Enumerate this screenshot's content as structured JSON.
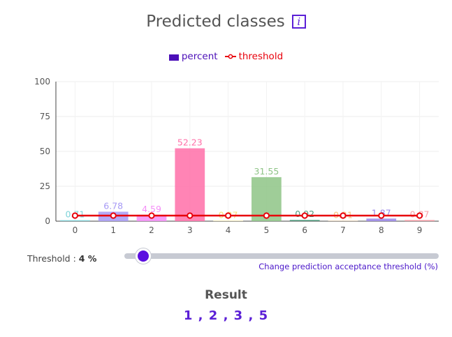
{
  "header": {
    "title": "Predicted classes",
    "info_glyph": "i"
  },
  "legend": {
    "percent_label": "percent",
    "threshold_label": "threshold"
  },
  "chart_data": {
    "type": "bar",
    "categories": [
      "0",
      "1",
      "2",
      "3",
      "4",
      "5",
      "6",
      "7",
      "8",
      "9"
    ],
    "series": [
      {
        "name": "percent",
        "values": [
          0.71,
          6.78,
          4.59,
          52.23,
          0.27,
          31.55,
          0.92,
          0.21,
          1.87,
          0.87
        ],
        "labels": [
          "0.71",
          "6.78",
          "4.59",
          "52.23",
          "0.27",
          "31.55",
          "0.92",
          "0.21",
          "1.87",
          "0.87"
        ],
        "colors": [
          "#7ed3d9",
          "#a79af5",
          "#f48df7",
          "#ff6fa8",
          "#f6e27a",
          "#8ec486",
          "#4f9a7d",
          "#f7c27a",
          "#9a86e8",
          "#f7a0a8"
        ]
      },
      {
        "name": "threshold",
        "type": "line",
        "values": [
          4,
          4,
          4,
          4,
          4,
          4,
          4,
          4,
          4,
          4
        ],
        "color": "#e8000b"
      }
    ],
    "y_ticks": [
      "0",
      "25",
      "50",
      "75",
      "100"
    ],
    "ylim": [
      0,
      100
    ],
    "grid": true,
    "legend_position": "top-center"
  },
  "threshold": {
    "label": "Threshold :",
    "value_text": "4 %",
    "value": 4,
    "max": 100
  },
  "slider_hint": "Change prediction acceptance threshold (%)",
  "result": {
    "title": "Result",
    "values": "1 , 2 , 3 , 5"
  },
  "colors": {
    "accent": "#5b1fd6",
    "threshold": "#e8000b",
    "legend_percent": "#4b0fb8"
  },
  "icons": {
    "info": "info-icon",
    "slider": "slider-thumb"
  }
}
